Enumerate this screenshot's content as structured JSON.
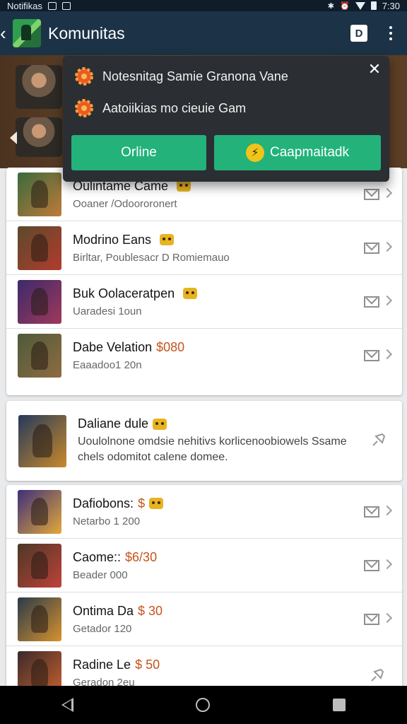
{
  "status_bar": {
    "left_text": "Notifikas",
    "time": "7:30"
  },
  "app_bar": {
    "title": "Komunitas",
    "action_label": "D"
  },
  "popup": {
    "items": [
      {
        "text": "Notesnitag Samie Granona Vane",
        "icon": "gear-icon"
      },
      {
        "text": "Aatoiikias mo cieuie Gam",
        "icon": "gear-icon"
      }
    ],
    "close_label": "✕",
    "buttons": [
      {
        "label": "Orline"
      },
      {
        "label": "Caapmaitadk",
        "icon": "bolt-icon"
      }
    ]
  },
  "list_top": [
    {
      "title": "Oulintame Came",
      "price": "",
      "sub": "Ooaner /Odoororonert",
      "colors": [
        "#3a6a3c",
        "#c07a3a"
      ]
    },
    {
      "title": "Modrino Eans",
      "price": "",
      "sub": "Birltar, Poublesacr D Romiemauo",
      "colors": [
        "#5a4a2c",
        "#b33b2c"
      ]
    },
    {
      "title": "Buk Oolaceratpen",
      "price": "",
      "sub": "Uaradesi 1oun",
      "colors": [
        "#3b2a6b",
        "#a0385a"
      ]
    },
    {
      "title": "Dabe Velation",
      "price": "$080",
      "sub": "Eaaadoo1 20n",
      "colors": [
        "#4d5a3a",
        "#8f6b42"
      ]
    }
  ],
  "featured": {
    "title": "Daliane dule",
    "sub": "Uoulolnone omdsie nehitivs korlicenoobiowels Ssame chels odomitot calene domee.",
    "colors": [
      "#243a5a",
      "#c9892c"
    ]
  },
  "list_bottom": [
    {
      "title": "Dafiobons:",
      "price": "$",
      "sub": "Netarbo 1 200",
      "colors": [
        "#3e2f7a",
        "#e2a83a"
      ]
    },
    {
      "title": "Caome::",
      "price": "$6/30",
      "sub": "Beader 000",
      "colors": [
        "#4a3826",
        "#c0413a"
      ]
    },
    {
      "title": "Ontima Da",
      "price": "$ 30",
      "sub": "Getador 120",
      "colors": [
        "#2a3a4a",
        "#d6922e"
      ]
    },
    {
      "title": "Radine Le",
      "price": "$ 50",
      "sub": "Geradon 2eu",
      "colors": [
        "#3a2a2a",
        "#c7602e"
      ]
    }
  ]
}
